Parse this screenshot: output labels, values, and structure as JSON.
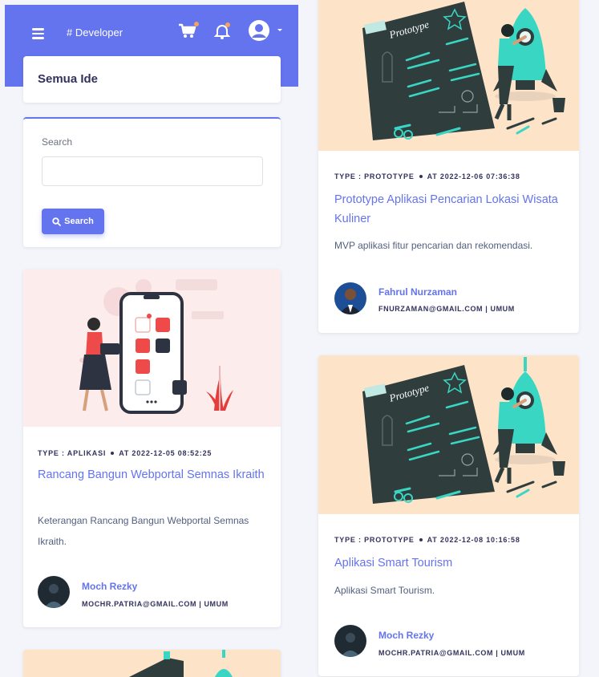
{
  "topbar": {
    "brand": "# Developer",
    "icons": [
      "menu-icon",
      "cart-icon",
      "bell-icon",
      "user-icon",
      "caret-down-icon"
    ]
  },
  "page": {
    "title": "Semua Ide"
  },
  "search": {
    "label": "Search",
    "value": "",
    "placeholder": "",
    "button_label": "Search"
  },
  "ideas": [
    {
      "type_label": "TYPE : APLIKASI",
      "date_label": "AT 2022-12-05 08:52:25",
      "title": "Rancang Bangun Webportal Semnas Ikraith",
      "description": "Keterangan Rancang Bangun Webportal Semnas Ikraith.",
      "author": "Moch Rezky",
      "email_line": "MOCHR.PATRIA@GMAIL.COM | UMUM",
      "illustration": "phone-app-illustration"
    },
    {
      "type_label": "TYPE : PROTOTYPE",
      "date_label": "AT 2022-12-06 07:36:38",
      "title": "Prototype Aplikasi Pencarian Lokasi Wisata Kuliner",
      "description": "MVP aplikasi fitur pencarian dan rekomendasi.",
      "author": "Fahrul Nurzaman",
      "email_line": "FNURZAMAN@GMAIL.COM | UMUM",
      "illustration": "prototype-rocket-illustration",
      "board_text": "Prototype"
    },
    {
      "type_label": "TYPE : PROTOTYPE",
      "date_label": "AT 2022-12-08 10:16:58",
      "title": "Aplikasi Smart Tourism",
      "description": "Aplikasi Smart Tourism.",
      "author": "Moch Rezky",
      "email_line": "MOCHR.PATRIA@GMAIL.COM | UMUM",
      "illustration": "prototype-rocket-illustration",
      "board_text": "Prototype"
    }
  ],
  "colors": {
    "primary": "#6474ee",
    "heading": "#32325d",
    "page_bg": "#f4f5fa",
    "illustration_bg_pink": "#fdecec",
    "illustration_bg_peach": "#fde3c8",
    "accent_teal": "#3ad6c4",
    "accent_red": "#ef4a4a"
  }
}
